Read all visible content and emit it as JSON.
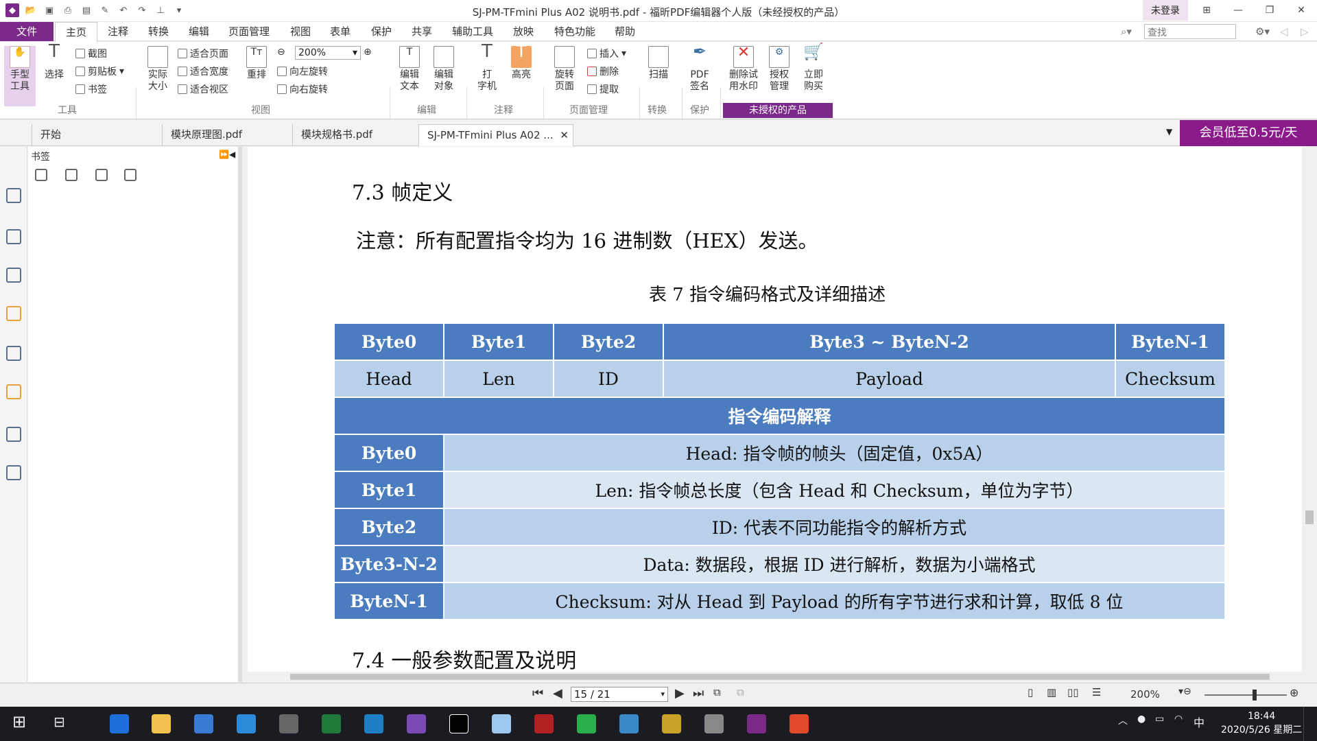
{
  "window": {
    "title": "SJ-PM-TFmini Plus A02 说明书.pdf - 福昕PDF编辑器个人版（未经授权的产品）",
    "login": "未登录"
  },
  "menu": {
    "file": "文件",
    "items": [
      "主页",
      "注释",
      "转换",
      "编辑",
      "页面管理",
      "视图",
      "表单",
      "保护",
      "共享",
      "辅助工具",
      "放映",
      "特色功能",
      "帮助"
    ],
    "search_placeholder": "查找"
  },
  "ribbon": {
    "hand": "手型\n工具",
    "select": "选择",
    "screenshot": "截图",
    "clipboard": "剪贴板",
    "bookmark": "书签",
    "actual_size": "实际\n大小",
    "fit_page": "适合页面",
    "fit_width": "适合宽度",
    "fit_view": "适合视区",
    "reflow": "重排",
    "zoom": "200%",
    "rotate_left": "向左旋转",
    "rotate_right": "向右旋转",
    "edit_text": "编辑\n文本",
    "edit_object": "编辑\n对象",
    "typewriter": "打\n字机",
    "highlight": "高亮",
    "rotate_page": "旋转\n页面",
    "insert": "插入",
    "delete": "删除",
    "extract": "提取",
    "scan": "扫描",
    "pdf_sign": "PDF\n签名",
    "remove_watermark": "删除试\n用水印",
    "license": "授权\n管理",
    "buy": "立即\n购买",
    "groups": {
      "tools": "工具",
      "view": "视图",
      "edit": "编辑",
      "comment": "注释",
      "page": "页面管理",
      "convert": "转换",
      "protect": "保护"
    },
    "unlicensed": "未授权的产品"
  },
  "tabs": [
    "开始",
    "模块原理图.pdf",
    "模块规格书.pdf",
    "SJ-PM-TFmini Plus A02 ..."
  ],
  "promo": "会员低至0.5元/天",
  "panel": {
    "title": "书签"
  },
  "doc": {
    "heading73": "7.3 帧定义",
    "note": "注意：所有配置指令均为 16 进制数（HEX）发送。",
    "caption": "表  7  指令编码格式及详细描述",
    "table": {
      "header": [
        "Byte0",
        "Byte1",
        "Byte2",
        "Byte3 ~ ByteN-2",
        "ByteN-1"
      ],
      "row": [
        "Head",
        "Len",
        "ID",
        "Payload",
        "Checksum"
      ],
      "section": "指令编码解释",
      "desc": [
        {
          "k": "Byte0",
          "v": "Head:  指令帧的帧头（固定值，0x5A）"
        },
        {
          "k": "Byte1",
          "v": "Len:  指令帧总长度（包含 Head 和 Checksum，单位为字节）"
        },
        {
          "k": "Byte2",
          "v": "ID:  代表不同功能指令的解析方式"
        },
        {
          "k": "Byte3-N-2",
          "v": "Data:  数据段，根据 ID 进行解析，数据为小端格式"
        },
        {
          "k": "ByteN-1",
          "v": "Checksum:  对从 Head 到 Payload 的所有字节进行求和计算，取低 8 位"
        }
      ]
    },
    "heading74": "7.4 一般参数配置及说明"
  },
  "status": {
    "page": "15 / 21",
    "zoom": "200%"
  },
  "clock": {
    "time": "18:44",
    "date": "2020/5/26 星期二"
  },
  "tray": {
    "ime": "中"
  }
}
